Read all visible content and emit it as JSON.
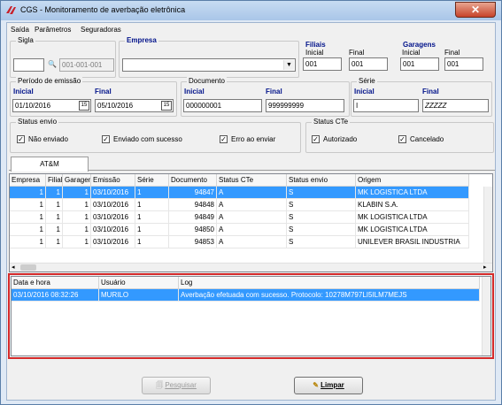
{
  "window": {
    "title": "CGS - Monitoramento de averbação eletrônica",
    "close_glyph": "✕"
  },
  "menu": [
    "Saída",
    "Parâmetros",
    "Seguradoras"
  ],
  "filters": {
    "sigla": {
      "label": "Sigla",
      "value": "",
      "lookup_value": "001-001-001"
    },
    "empresa": {
      "label": "Empresa",
      "value": ""
    },
    "filiais": {
      "label": "Filiais",
      "inicial_label": "Inicial",
      "final_label": "Final",
      "inicial": "001",
      "final": "001"
    },
    "garagens": {
      "label": "Garagens",
      "inicial_label": "Inicial",
      "final_label": "Final",
      "inicial": "001",
      "final": "001"
    },
    "periodo": {
      "label": "Período de emissão",
      "inicial_label": "Inicial",
      "final_label": "Final",
      "inicial": "01/10/2016",
      "final": "05/10/2016"
    },
    "documento": {
      "label": "Documento",
      "inicial_label": "Inicial",
      "final_label": "Final",
      "inicial": "000000001",
      "final": "999999999"
    },
    "serie": {
      "label": "Série",
      "inicial_label": "Inicial",
      "final_label": "Final",
      "inicial": "I",
      "final": "ZZZZZ"
    },
    "status_envio": {
      "label": "Status envio",
      "options": [
        {
          "label": "Não enviado",
          "checked": true
        },
        {
          "label": "Enviado com sucesso",
          "checked": true
        },
        {
          "label": "Erro ao enviar",
          "checked": true
        }
      ]
    },
    "status_cte": {
      "label": "Status CTe",
      "options": [
        {
          "label": "Autorizado",
          "checked": true
        },
        {
          "label": "Cancelado",
          "checked": true
        }
      ]
    }
  },
  "tabs": [
    {
      "label": "AT&M"
    }
  ],
  "documents_table": {
    "columns": [
      "Empresa",
      "Filial",
      "Garagem",
      "Emissão",
      "Série",
      "Documento",
      "Status CTe",
      "Status envio",
      "Origem"
    ],
    "rows": [
      [
        "1",
        "1",
        "1",
        "03/10/2016",
        "1",
        "94847",
        "A",
        "S",
        "MK LOGISTICA LTDA"
      ],
      [
        "1",
        "1",
        "1",
        "03/10/2016",
        "1",
        "94848",
        "A",
        "S",
        "KLABIN S.A."
      ],
      [
        "1",
        "1",
        "1",
        "03/10/2016",
        "1",
        "94849",
        "A",
        "S",
        "MK LOGISTICA LTDA"
      ],
      [
        "1",
        "1",
        "1",
        "03/10/2016",
        "1",
        "94850",
        "A",
        "S",
        "MK LOGISTICA LTDA"
      ],
      [
        "1",
        "1",
        "1",
        "03/10/2016",
        "1",
        "94853",
        "A",
        "S",
        "UNILEVER BRASIL INDUSTRIA"
      ]
    ],
    "selected_row": 0
  },
  "log_table": {
    "columns": [
      "Data e hora",
      "Usuário",
      "Log"
    ],
    "rows": [
      [
        "03/10/2016 08:32:26",
        "MURILO",
        "Averbação efetuada com sucesso. Protocolo: 10278M797LI5ILM7MEJS"
      ]
    ],
    "selected_row": 0
  },
  "buttons": {
    "pesquisar": "Pesquisar",
    "limpar": "Limpar"
  }
}
